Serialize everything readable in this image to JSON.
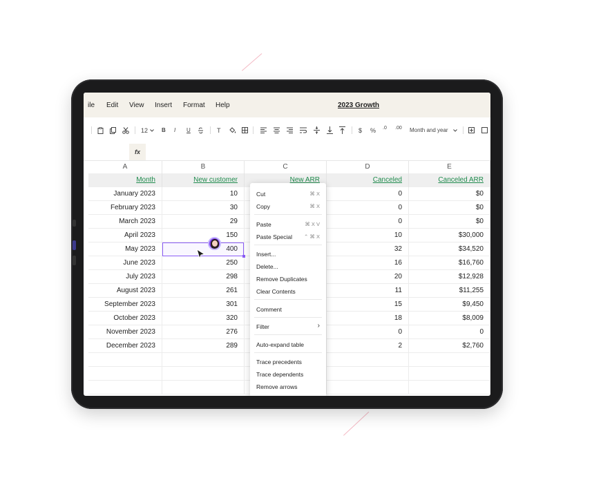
{
  "menubar": {
    "items": [
      "ile",
      "Edit",
      "View",
      "Insert",
      "Format",
      "Help"
    ],
    "doc_title": "2023 Growth"
  },
  "toolbar": {
    "font_size": "12",
    "number_format": "Month and year",
    "bold": "B",
    "italic": "I",
    "underline": "U",
    "text_tool": "T",
    "dollar": "$",
    "percent": "%",
    "decrease_decimals": ".0",
    "increase_decimals": ".00",
    "icons": [
      "clipboard-icon",
      "copy-icon",
      "cut-icon",
      "bold-icon",
      "italic-icon",
      "underline-icon",
      "strikethrough-icon",
      "text-color-icon",
      "fill-color-icon",
      "borders-icon",
      "align-left-icon",
      "align-center-icon",
      "align-right-icon",
      "wrap-icon",
      "valign-middle-icon",
      "valign-bottom-icon",
      "valign-top-icon",
      "currency-icon",
      "percent-icon",
      "decrease-decimal-icon",
      "increase-decimal-icon",
      "insert-icon"
    ]
  },
  "formula_bar": {
    "fx_label": "fx"
  },
  "sheet": {
    "columns": [
      "A",
      "B",
      "C",
      "D",
      "E"
    ],
    "headers": [
      "Month",
      "New customer",
      "New ARR",
      "Canceled",
      "Canceled ARR"
    ],
    "rows": [
      {
        "month": "January 2023",
        "new_customer": "10",
        "canceled": "0",
        "canceled_arr": "$0"
      },
      {
        "month": "February 2023",
        "new_customer": "30",
        "canceled": "0",
        "canceled_arr": "$0"
      },
      {
        "month": "March 2023",
        "new_customer": "29",
        "canceled": "0",
        "canceled_arr": "$0"
      },
      {
        "month": "April 2023",
        "new_customer": "150",
        "canceled": "10",
        "canceled_arr": "$30,000"
      },
      {
        "month": "May 2023",
        "new_customer": "400",
        "canceled": "32",
        "canceled_arr": "$34,520"
      },
      {
        "month": "June 2023",
        "new_customer": "250",
        "canceled": "16",
        "canceled_arr": "$16,760"
      },
      {
        "month": "July 2023",
        "new_customer": "298",
        "canceled": "20",
        "canceled_arr": "$12,928"
      },
      {
        "month": "August 2023",
        "new_customer": "261",
        "canceled": "11",
        "canceled_arr": "$11,255"
      },
      {
        "month": "September 2023",
        "new_customer": "301",
        "canceled": "15",
        "canceled_arr": "$9,450"
      },
      {
        "month": "October 2023",
        "new_customer": "320",
        "canceled": "18",
        "canceled_arr": "$8,009"
      },
      {
        "month": "November 2023",
        "new_customer": "276",
        "canceled": "0",
        "canceled_arr": "0"
      },
      {
        "month": "December 2023",
        "new_customer": "289",
        "canceled": "2",
        "canceled_arr": "$2,760"
      }
    ],
    "header_color": "#1e8a4c",
    "selection_color": "#8b5cf6"
  },
  "context_menu": {
    "groups": [
      [
        {
          "label": "Cut",
          "shortcut": "⌘ X"
        },
        {
          "label": "Copy",
          "shortcut": "⌘ X"
        }
      ],
      [
        {
          "label": "Paste",
          "shortcut": "⌘ X V"
        },
        {
          "label": "Paste Special",
          "shortcut": "⌃ ⌘ X"
        }
      ],
      [
        {
          "label": "Insert...",
          "shortcut": ""
        },
        {
          "label": "Delete...",
          "shortcut": ""
        },
        {
          "label": "Remove Duplicates",
          "shortcut": ""
        },
        {
          "label": "Clear Contents",
          "shortcut": ""
        }
      ],
      [
        {
          "label": "Comment",
          "shortcut": ""
        }
      ],
      [
        {
          "label": "Filter",
          "shortcut": "›"
        }
      ],
      [
        {
          "label": "Auto-expand table",
          "shortcut": ""
        }
      ],
      [
        {
          "label": "Trace precedents",
          "shortcut": ""
        },
        {
          "label": "Trace dependents",
          "shortcut": ""
        },
        {
          "label": "Remove arrows",
          "shortcut": ""
        }
      ]
    ]
  }
}
